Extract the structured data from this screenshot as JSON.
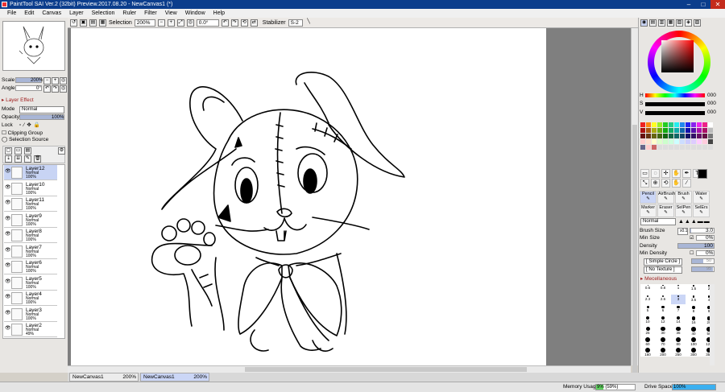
{
  "window": {
    "title": "PaintTool SAI Ver.2 (32bit) Preview.2017.08.20 - NewCanvas1 (*)"
  },
  "menu": [
    "File",
    "Edit",
    "Canvas",
    "Layer",
    "Selection",
    "Ruler",
    "Filter",
    "View",
    "Window",
    "Help"
  ],
  "toolbar": {
    "selection_label": "Selection",
    "zoom": "200%",
    "angle": "0.0°",
    "stabilizer_label": "Stabilizer",
    "stabilizer_value": "S-2"
  },
  "navigator": {
    "scale_label": "Scale",
    "scale_value": "200%",
    "angle_label": "Angle",
    "angle_value": "0°"
  },
  "layer_panel": {
    "effect_label": "Layer Effect",
    "mode_label": "Mode",
    "mode_value": "Normal",
    "opacity_label": "Opacity",
    "opacity_value": "100%",
    "lock_label": "Lock",
    "clipping_label": "Clipping Group",
    "selection_source_label": "Selection Source",
    "layers": [
      {
        "name": "Layer12",
        "mode": "Normal",
        "opacity": "100%"
      },
      {
        "name": "Layer10",
        "mode": "Normal",
        "opacity": "100%"
      },
      {
        "name": "Layer11",
        "mode": "Normal",
        "opacity": "100%"
      },
      {
        "name": "Layer9",
        "mode": "Normal",
        "opacity": "100%"
      },
      {
        "name": "Layer8",
        "mode": "Normal",
        "opacity": "100%"
      },
      {
        "name": "Layer7",
        "mode": "Normal",
        "opacity": "100%"
      },
      {
        "name": "Layer6",
        "mode": "Normal",
        "opacity": "100%"
      },
      {
        "name": "Layer5",
        "mode": "Normal",
        "opacity": "100%"
      },
      {
        "name": "Layer4",
        "mode": "Normal",
        "opacity": "100%"
      },
      {
        "name": "Layer3",
        "mode": "Normal",
        "opacity": "100%"
      },
      {
        "name": "Layer2",
        "mode": "Normal",
        "opacity": "49%"
      }
    ]
  },
  "color_panel": {
    "h_label": "H",
    "h_value": "000",
    "s_label": "S",
    "s_value": "000",
    "v_label": "V",
    "v_value": "000"
  },
  "tools": {
    "row1": [
      "Pencil",
      "AirBrush",
      "Brush",
      "Water"
    ],
    "row2": [
      "Marker",
      "Eraser",
      "SelPen",
      "SelErs"
    ],
    "blend_mode": "Normal",
    "brush_size_label": "Brush Size",
    "brush_size_multiplier": "x0.1",
    "brush_size_value": "3.0",
    "min_size_label": "Min Size",
    "min_size_value": "0%",
    "density_label": "Density",
    "density_value": "100",
    "min_density_label": "Min Density",
    "min_density_value": "0%",
    "shape_value": "[ Simple Circle ]",
    "shape_value2": "50",
    "texture_value": "[ No Texture ]",
    "texture_value2": "95",
    "misc_label": "Mecellaneous"
  },
  "brush_sizes": [
    "0.6",
    "0.8",
    "1",
    "1.5",
    "2",
    "2.3",
    "2.6",
    "3",
    "3.5",
    "4",
    "5",
    "6",
    "7",
    "8",
    "9",
    "10",
    "12",
    "14",
    "16",
    "20",
    "25",
    "30",
    "35",
    "40",
    "50",
    "60",
    "70",
    "80",
    "100",
    "120",
    "160",
    "200",
    "250",
    "300",
    "350"
  ],
  "tabs": [
    {
      "name": "NewCanvas1",
      "zoom": "200%"
    },
    {
      "name": "NewCanvas1",
      "zoom": "200%"
    }
  ],
  "status": {
    "memory_label": "Memory Usage",
    "memory_value": "9% (59%)",
    "drive_label": "Drive Space",
    "drive_value": "100%"
  },
  "colors": {
    "titlebar": "#0b3d8c",
    "accent": "#cbd6f6"
  }
}
